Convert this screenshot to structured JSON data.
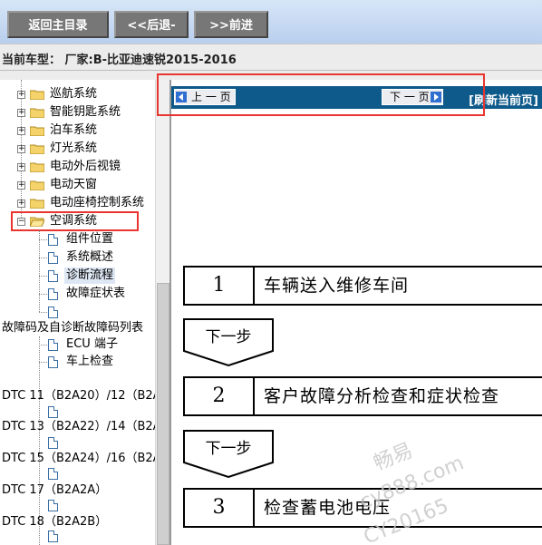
{
  "toolbar": {
    "home_label": "返回主目录",
    "back_label": "<<后退-",
    "forward_label": ">>前进"
  },
  "status": {
    "current_model": "当前车型： 厂家:B-比亚迪速锐2015-2016"
  },
  "tree": {
    "folders": [
      "巡航系统",
      "智能钥匙系统",
      "泊车系统",
      "灯光系统",
      "电动外后视镜",
      "电动天窗",
      "电动座椅控制系统",
      "空调系统"
    ],
    "ac_children": [
      "组件位置",
      "系统概述",
      "诊断流程",
      "故障症状表",
      ""
    ],
    "dtc_header": "故障码及自诊断故障码列表",
    "dtc_children": [
      "ECU 端子",
      "车上检查"
    ],
    "dtc_items": [
      "DTC 11（B2A20）/12（B2A",
      "DTC 13（B2A22）/14（B2A",
      "DTC 15（B2A24）/16（B2A",
      "DTC 17（B2A2A）",
      "DTC 18（B2A2B）"
    ]
  },
  "content": {
    "prev_page": "上 一 页",
    "next_page": "下 一 页",
    "refresh": "[刷新当前页]",
    "steps": [
      {
        "num": "1",
        "text": "车辆送入维修车间"
      },
      {
        "num": "2",
        "text": "客户故障分析检查和症状检查"
      },
      {
        "num": "3",
        "text": "检查蓄电池电压"
      }
    ],
    "next_step_label": "下一步",
    "watermark_1": "畅易",
    "watermark_2": "cy888.com",
    "watermark_3": "CY20165"
  }
}
